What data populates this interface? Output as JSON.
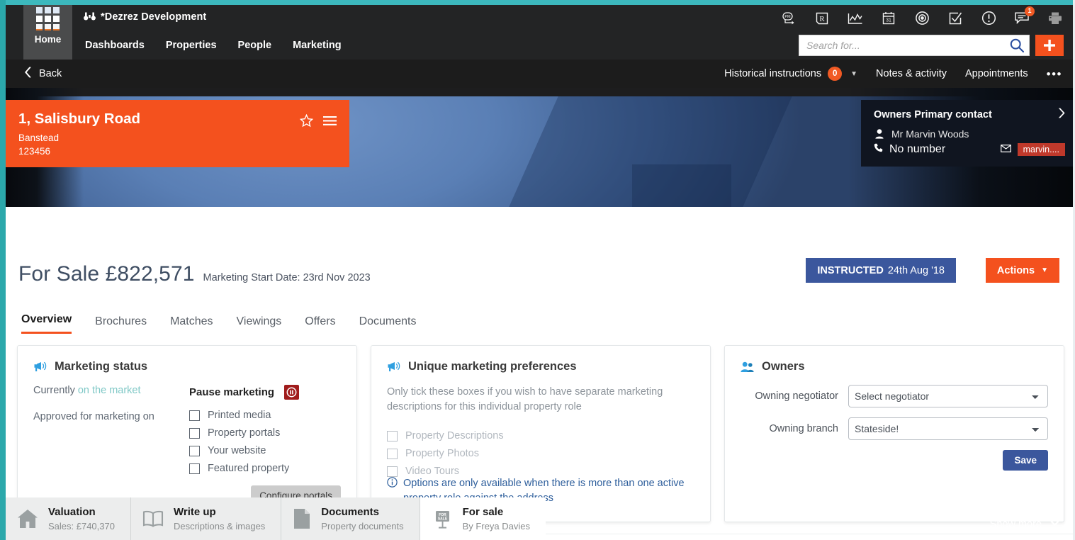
{
  "colors": {
    "accent_orange": "#f4511e",
    "teal_edge": "#2ba8ab",
    "topbar_dark": "#232425",
    "instructed_blue": "#3b579d",
    "pause_red": "#a01c1c",
    "link_blue": "#2c5d9b"
  },
  "topbar": {
    "app_title": "*Dezrez Development",
    "icons": [
      {
        "name": "pm-arrow-icon",
        "label": "PM"
      },
      {
        "name": "registered-r-icon",
        "label": "R"
      },
      {
        "name": "chart-icon",
        "label": "Reports"
      },
      {
        "name": "calendar-icon",
        "label": "Diary"
      },
      {
        "name": "target-icon",
        "label": "Targets"
      },
      {
        "name": "checkbox-tick-icon",
        "label": "Tasks"
      },
      {
        "name": "exclamation-icon",
        "label": "Alerts"
      },
      {
        "name": "chat-bubble-icon",
        "label": "Messages",
        "badge": "1"
      },
      {
        "name": "printer-icon",
        "label": "Print"
      }
    ]
  },
  "nav": {
    "home_label": "Home",
    "links": [
      "Dashboards",
      "Properties",
      "People",
      "Marketing"
    ],
    "search_placeholder": "Search for...",
    "search_value": "",
    "add_label": "+"
  },
  "subbar": {
    "back_label": "Back",
    "historical_instructions": "Historical instructions",
    "historical_count": "0",
    "notes_activity": "Notes & activity",
    "appointments": "Appointments",
    "more": "•••"
  },
  "property": {
    "address_line1": "1, Salisbury Road",
    "address_line2": "Banstead",
    "reference": "123456"
  },
  "contact": {
    "heading": "Owners Primary contact",
    "name": "Mr Marvin Woods",
    "phone": "No number",
    "email_pill": "marvin...."
  },
  "hero_tabs": [
    {
      "title": "Valuation",
      "sub": "Sales: £740,370",
      "icon": "house-icon",
      "active": false
    },
    {
      "title": "Write up",
      "sub": "Descriptions & images",
      "icon": "book-icon",
      "active": false
    },
    {
      "title": "Documents",
      "sub": "Property documents",
      "icon": "document-icon",
      "active": false
    },
    {
      "title": "For sale",
      "sub": "By Freya Davies",
      "icon": "for-sale-board-icon",
      "active": true
    }
  ],
  "show_more": "Show more",
  "main": {
    "title": "For Sale £822,571",
    "marketing_start_date": "Marketing Start Date: 23rd Nov 2023",
    "instructed_label": "INSTRUCTED",
    "instructed_date": "24th Aug '18",
    "actions_label": "Actions",
    "tabs": [
      {
        "label": "Overview",
        "active": true
      },
      {
        "label": "Brochures",
        "active": false
      },
      {
        "label": "Matches",
        "active": false
      },
      {
        "label": "Viewings",
        "active": false
      },
      {
        "label": "Offers",
        "active": false
      },
      {
        "label": "Documents",
        "active": false
      }
    ]
  },
  "marketing_status": {
    "heading": "Marketing status",
    "currently_prefix": "Currently",
    "currently_value": "on the market",
    "approved_label": "Approved for marketing on",
    "pause_label": "Pause marketing",
    "checkboxes": [
      {
        "label": "Printed media",
        "checked": false
      },
      {
        "label": "Property portals",
        "checked": false
      },
      {
        "label": "Your website",
        "checked": false
      },
      {
        "label": "Featured property",
        "checked": false
      }
    ],
    "configure_label": "Configure portals"
  },
  "unique_marketing": {
    "heading": "Unique marketing preferences",
    "description": "Only tick these boxes if you wish to have separate marketing descriptions for this individual property role",
    "checkboxes": [
      {
        "label": "Property Descriptions",
        "checked": false
      },
      {
        "label": "Property Photos",
        "checked": false
      },
      {
        "label": "Video Tours",
        "checked": false
      }
    ],
    "note": "Options are only available when there is more than one active property role against the address"
  },
  "owners": {
    "heading": "Owners",
    "negotiator_label": "Owning negotiator",
    "negotiator_value": "Select negotiator",
    "branch_label": "Owning branch",
    "branch_value": "Stateside!",
    "save_label": "Save"
  }
}
